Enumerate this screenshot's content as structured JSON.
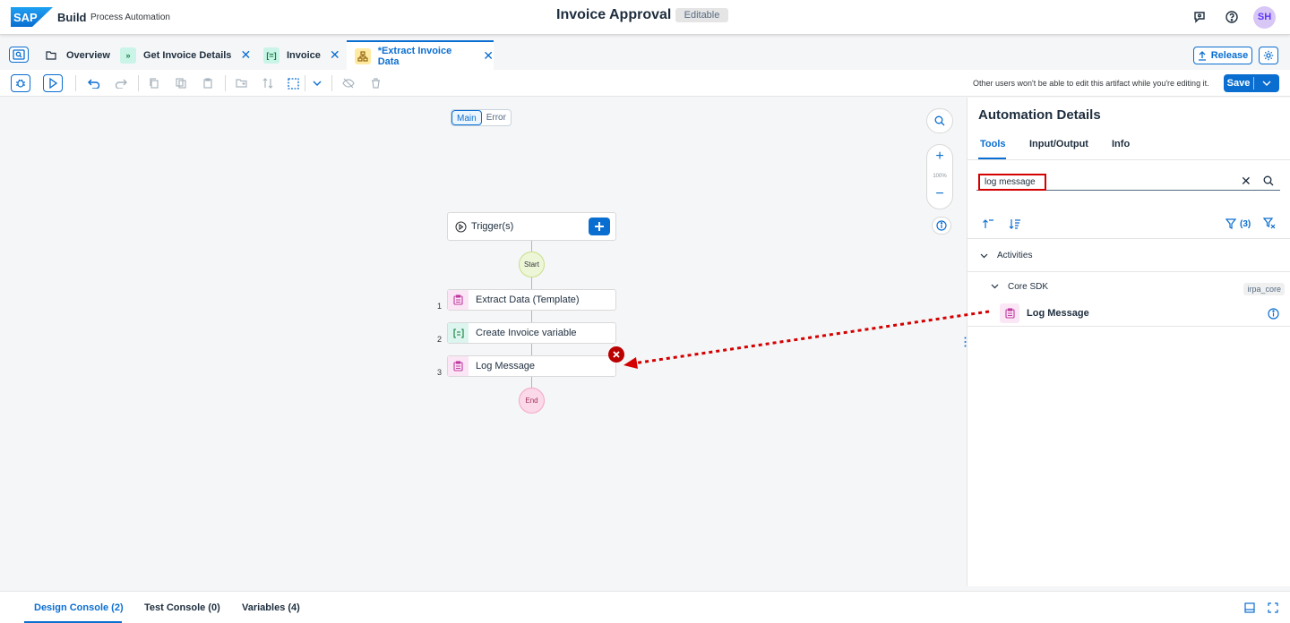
{
  "shell": {
    "logo_text": "SAP",
    "brand": "Build",
    "brand_sub": "Process Automation",
    "title": "Invoice Approval",
    "status": "Editable",
    "avatar": "SH"
  },
  "tabs": [
    {
      "label": "Overview",
      "icon": "folder-icon"
    },
    {
      "label": "Get Invoice Details",
      "icon": "process-icon",
      "closable": true
    },
    {
      "label": "Invoice",
      "icon": "variable-icon",
      "closable": true
    },
    {
      "label": "*Extract Invoice Data",
      "icon": "automation-icon",
      "closable": true,
      "active": true
    }
  ],
  "tab_actions": {
    "release": "Release"
  },
  "toolbar": {
    "edit_note": "Other users won't be able to edit this artifact while you're editing it.",
    "save": "Save"
  },
  "canvas": {
    "segments": [
      "Main",
      "Error"
    ],
    "zoom": "100%",
    "trigger": "Trigger(s)",
    "start": "Start",
    "end": "End",
    "steps": [
      {
        "num": "1",
        "label": "Extract Data (Template)",
        "icon": "clipboard-icon"
      },
      {
        "num": "2",
        "label": "Create Invoice variable",
        "icon": "variable-icon"
      },
      {
        "num": "3",
        "label": "Log Message",
        "icon": "clipboard-icon",
        "error": true
      }
    ]
  },
  "panel": {
    "title": "Automation Details",
    "tabs": [
      "Tools",
      "Input/Output",
      "Info"
    ],
    "search_value": "log message",
    "filter_count": "(3)",
    "section": "Activities",
    "subsection": "Core SDK",
    "badge": "irpa_core",
    "item": "Log Message"
  },
  "bottom": {
    "tabs": [
      "Design Console (2)",
      "Test Console (0)",
      "Variables (4)"
    ]
  },
  "colors": {
    "accent": "#0a6ed1",
    "error": "#bb0000",
    "highlight": "#d40000"
  }
}
